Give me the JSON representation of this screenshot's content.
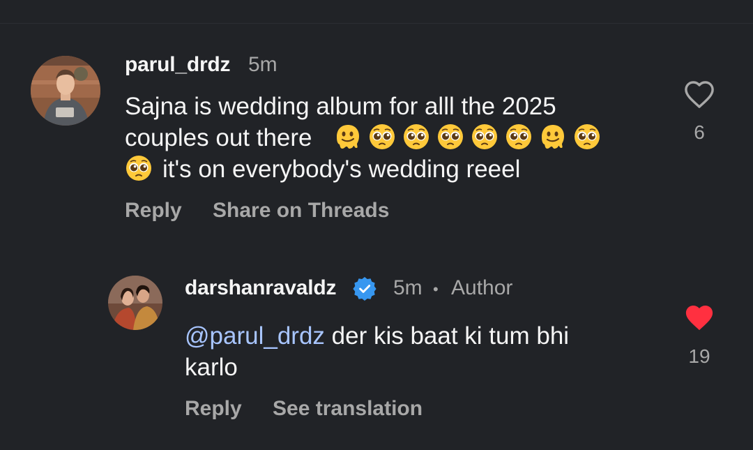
{
  "comments": [
    {
      "username": "parul_drdz",
      "time": "5m",
      "text_line1": "Sajna is wedding album for alll the 2025",
      "text_line2_prefix": "couples out there",
      "text_line3_suffix": "it's on everybody's wedding reeel",
      "emojis_line2": [
        "melting-face",
        "pleading-face",
        "pleading-face",
        "pleading-face",
        "pleading-face",
        "pleading-face",
        "melting-face",
        "pleading-face"
      ],
      "emojis_line3": [
        "pleading-face"
      ],
      "like_count": "6",
      "liked": false,
      "actions": [
        "Reply",
        "Share on Threads"
      ]
    },
    {
      "username": "darshanravaldz",
      "verified": true,
      "time": "5m",
      "separator": "•",
      "badge": "Author",
      "mention": "@parul_drdz",
      "text_rest_line1": " der kis baat ki tum bhi",
      "text_line2": "karlo",
      "like_count": "19",
      "liked": true,
      "actions": [
        "Reply",
        "See translation"
      ]
    }
  ],
  "colors": {
    "background": "#212327",
    "secondary_text": "#a8a8a8",
    "mention": "#a8c5ff",
    "like_red": "#ff3040",
    "verified_blue": "#3797f0"
  }
}
